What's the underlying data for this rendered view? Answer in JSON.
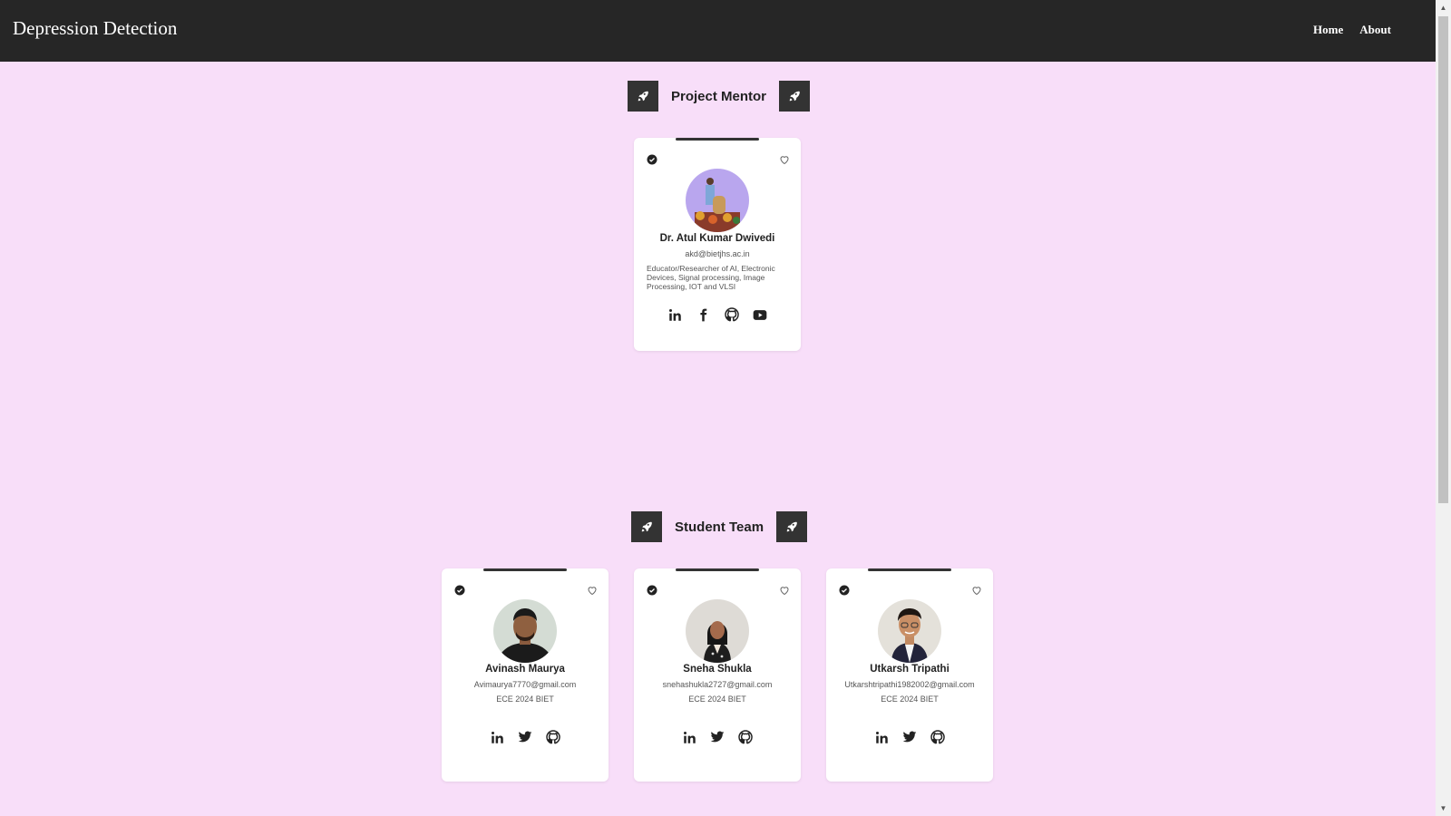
{
  "navbar": {
    "brand": "Depression Detection",
    "links": [
      "Home",
      "About"
    ]
  },
  "mentor_section": {
    "title": "Project Mentor",
    "card": {
      "name": "Dr. Atul Kumar Dwivedi",
      "email": "akd@bietjhs.ac.in",
      "description": "Educator/Researcher of AI, Electronic Devices, Signal processing, Image Processing, IOT and VLSI",
      "socials": [
        "linkedin-icon",
        "facebook-icon",
        "github-icon",
        "youtube-icon"
      ]
    }
  },
  "student_section": {
    "title": "Student Team",
    "cards": [
      {
        "name": "Avinash Maurya",
        "email": "Avimaurya7770@gmail.com",
        "subtitle": "ECE 2024 BIET",
        "socials": [
          "linkedin-icon",
          "twitter-icon",
          "github-icon"
        ]
      },
      {
        "name": "Sneha Shukla",
        "email": "snehashukla2727@gmail.com",
        "subtitle": "ECE 2024 BIET",
        "socials": [
          "linkedin-icon",
          "twitter-icon",
          "github-icon"
        ]
      },
      {
        "name": "Utkarsh Tripathi",
        "email": "Utkarshtripathi1982002@gmail.com",
        "subtitle": "ECE 2024 BIET",
        "socials": [
          "linkedin-icon",
          "twitter-icon",
          "github-icon"
        ]
      }
    ]
  },
  "colors": {
    "page_background": "#f8def9",
    "navbar": "#262626",
    "accent_dark": "#333333",
    "card": "#ffffff"
  }
}
